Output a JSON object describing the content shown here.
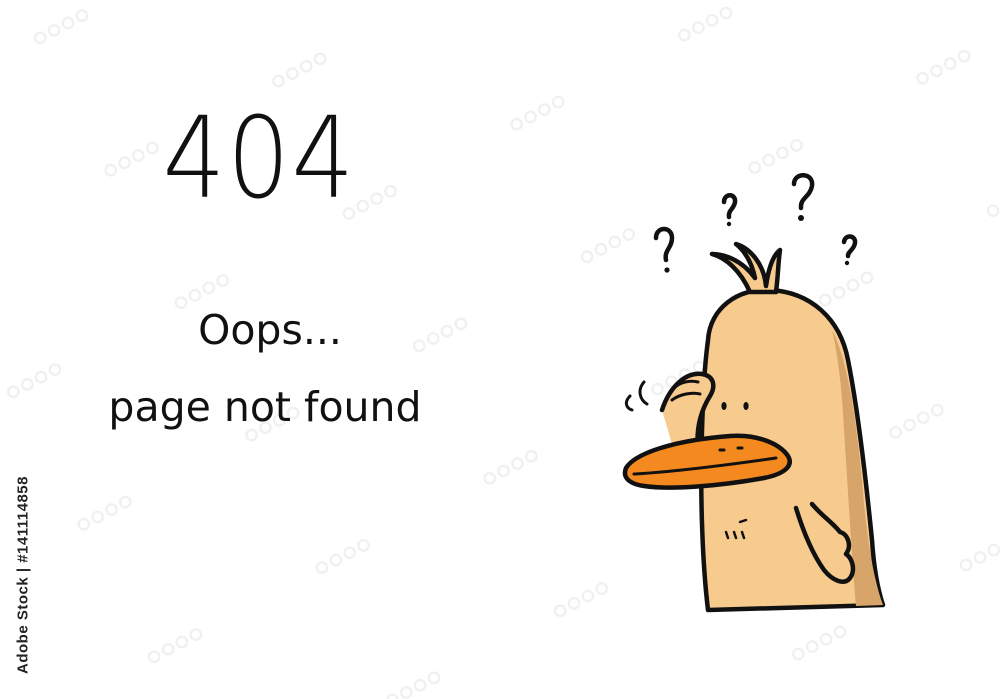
{
  "error": {
    "code": "404",
    "headline": "Oops...",
    "message": "page not found"
  },
  "stock_id": "Adobe Stock | #141114858",
  "illustration": {
    "subject": "confused duck scratching head",
    "colors": {
      "body": "#F7CA8E",
      "shadow": "#D7A56A",
      "beak": "#F4891F",
      "outline": "#111111"
    }
  }
}
